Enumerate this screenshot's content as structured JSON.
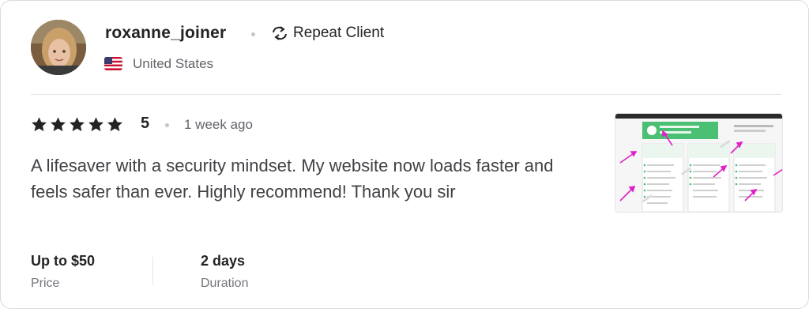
{
  "reviewer": {
    "username": "roxanne_joiner",
    "badge": "Repeat Client",
    "country": "United States",
    "avatar_icon": "user-avatar"
  },
  "review": {
    "rating": "5",
    "stars": 5,
    "time_ago": "1 week ago",
    "text": "A lifesaver with a security mindset. My website now loads faster and feels safer than ever. Highly recommend! Thank you sir"
  },
  "meta": {
    "price_value": "Up to $50",
    "price_label": "Price",
    "duration_value": "2 days",
    "duration_label": "Duration"
  },
  "colors": {
    "accent_green": "#4bbf73",
    "star": "#222325",
    "text_secondary": "#62646a"
  }
}
